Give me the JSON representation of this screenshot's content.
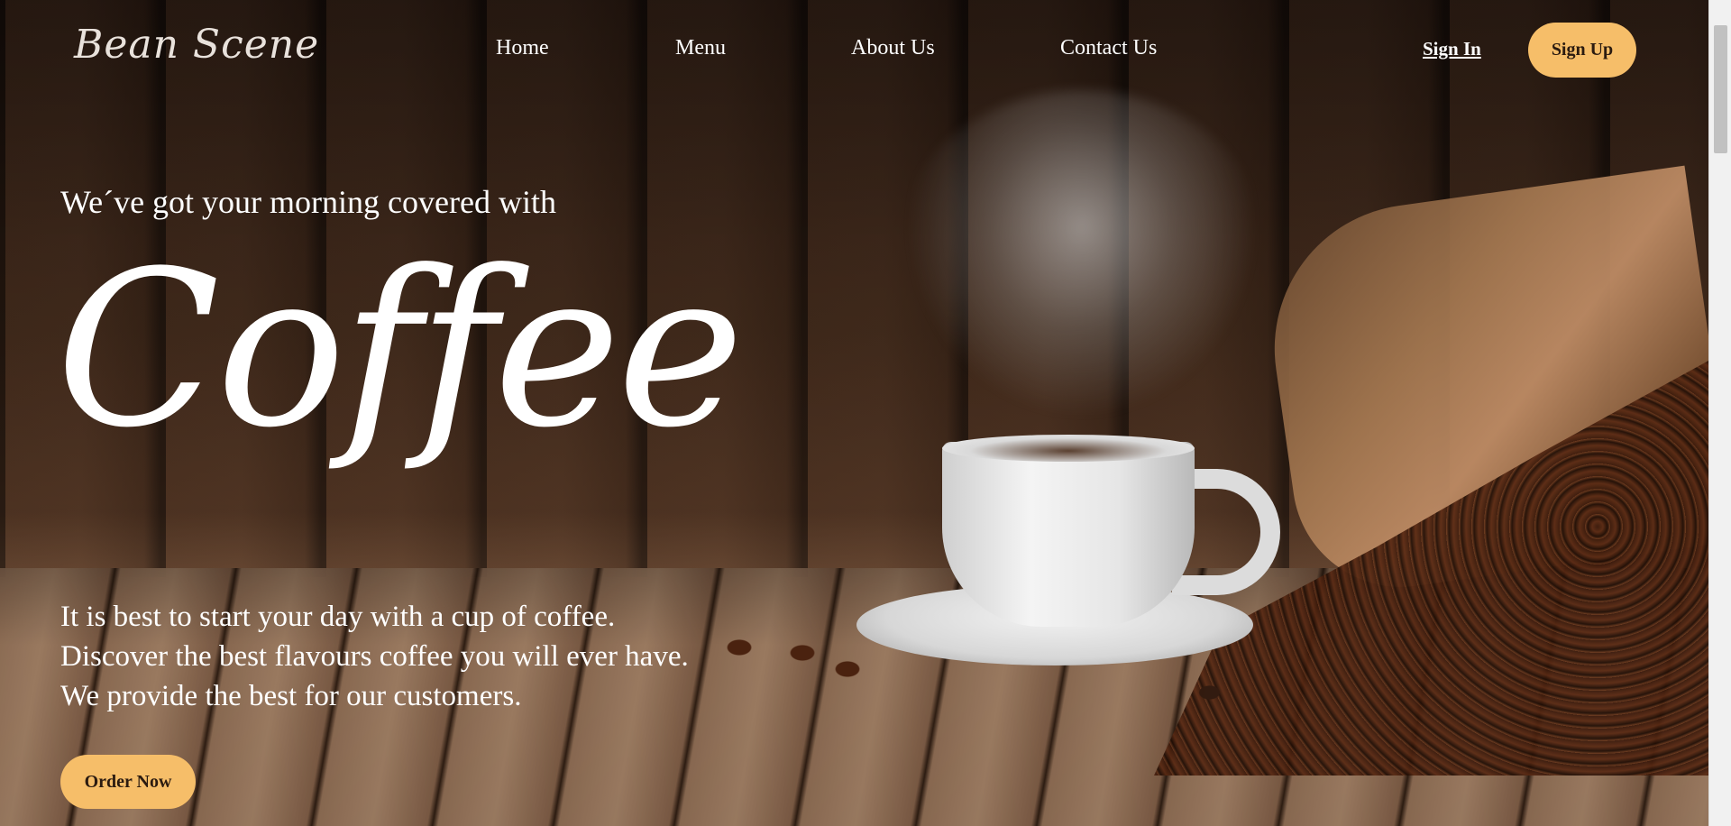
{
  "nav": {
    "logo": "Bean Scene",
    "links": [
      "Home",
      "Menu",
      "About Us",
      "Contact Us"
    ],
    "sign_in": "Sign In",
    "sign_up": "Sign Up"
  },
  "hero": {
    "tagline": "We´ve got your morning covered with",
    "title": "Coffee",
    "description": [
      "It is best to start your day with a cup of coffee.",
      "Discover the best flavours coffee you will ever have.",
      "We provide the best for our customers."
    ],
    "cta": "Order Now"
  },
  "colors": {
    "accent": "#f6be69",
    "text": "#ffffff",
    "button_text": "#2b1b10"
  }
}
